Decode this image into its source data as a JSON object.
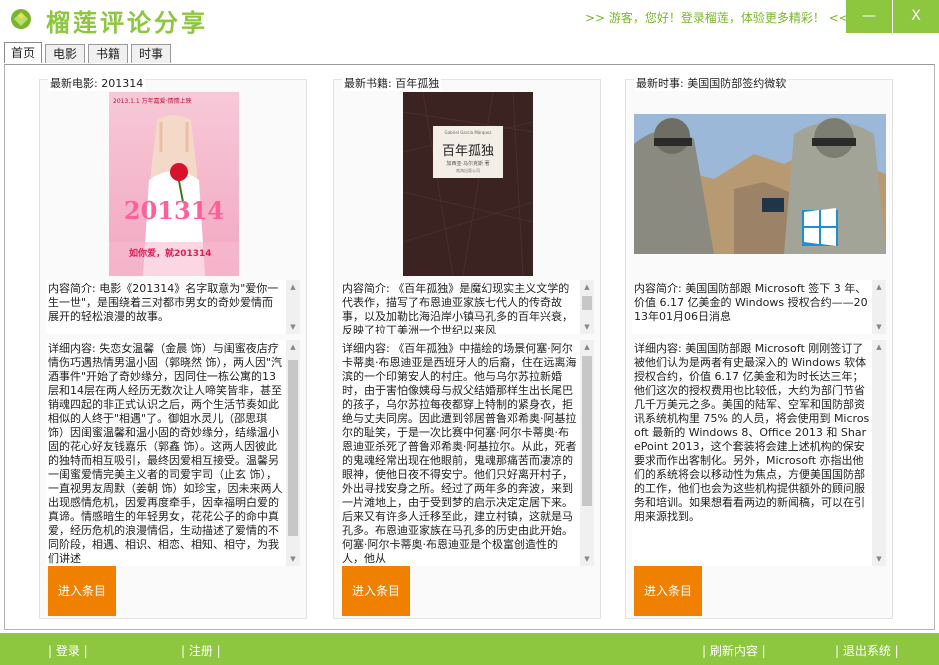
{
  "app": {
    "title": "榴莲评论分享",
    "guest_message": ">> 游客，您好！登录榴莲，体验更多精彩！ <<",
    "minimize_label": "—",
    "close_label": "X"
  },
  "tabs": [
    {
      "label": "首页",
      "active": true
    },
    {
      "label": "电影",
      "active": false
    },
    {
      "label": "书籍",
      "active": false
    },
    {
      "label": "时事",
      "active": false
    }
  ],
  "movie": {
    "heading": "最新电影: 201314",
    "poster_top_text": "2013.1.1 万年嘉爱·情情上映",
    "poster_big_text": "201314",
    "poster_small_text": "Forever Love",
    "poster_bottom_text": "如你爱，就201314",
    "summary": "内容简介: 电影《201314》名字取意为\"爱你一生一世\"，是围绕着三对都市男女的奇妙爱情而展开的轻松浪漫的故事。",
    "detail": "详细内容: 失恋女温馨（金晨 饰）与闺蜜夜店疗情伤巧遇热情男温小固（郭晓然 饰），两人因\"汽酒事件\"开始了奇妙缘分，因同住一栋公寓的13层和14层在两人经历无数次让人啼笑皆非，甚至销魂四起的非正式认识之后，两个生活节奏如此相似的人终于\"相遇\"了。御姐水灵儿（邵思琪 饰）因闺蜜温馨和温小固的奇妙缘分，结缘温小固的花心好友钱嘉乐（郭鑫 饰）。这两人因彼此的独特而相互吸引，最终因爱相互接受。温馨另一闺蜜爱情完美主义者的司爱宇司（止玄 饰），一直视男友周默（姜朝 饰）如珍宝，因未来两人出现感情危机，因爱再度牵手，因幸福明白爱的真谛。情感暗生的年轻男女，花花公子的命中真爱，经历危机的浪漫情侣，生动描述了爱情的不同阶段，相遇、相识、相恋、相知、相守，为我们讲述",
    "enter_label": "进入条目"
  },
  "book": {
    "heading": "最新书籍: 百年孤独",
    "cover_top_text": "Gabriel García Márquez",
    "cover_title": "百年孤独",
    "cover_author": "加西亚·马尔克斯 著",
    "cover_bottom_text": "南海出版公司",
    "summary": "内容简介: 《百年孤独》是魔幻现实主义文学的代表作，描写了布恩迪亚家族七代人的传奇故事，以及加勒比海沿岸小镇马孔多的百年兴衰，反映了拉丁美洲一个世纪以来风",
    "detail": "详细内容: 《百年孤独》中描绘的场景何塞·阿尔卡蒂奥·布恩迪亚是西班牙人的后裔，住在远离海滨的一个印第安人的村庄。他与乌尔苏拉新婚时，由于害怕像姨母与叔父结婚那样生出长尾巴的孩子，乌尔苏拉每夜都穿上特制的紧身衣，拒绝与丈夫同房。因此遭到邻居普鲁邓希奥·阿基拉尔的耻笑，于是一次比赛中何塞·阿尔卡蒂奥·布恩迪亚杀死了普鲁邓希奥·阿基拉尔。从此，死者的鬼魂经常出现在他眼前，鬼魂那痛苦而凄凉的眼神，使他日夜不得安宁。他们只好离开村子，外出寻找安身之所。经过了两年多的奔波，来到一片滩地上，由于受到梦的启示决定定居下来。后来又有许多人迁移至此，建立村镇，这就是马孔多。布恩迪亚家族在马孔多的历史由此开始。 何塞·阿尔卡蒂奥·布恩迪亚是个极富创造性的人，他从",
    "enter_label": "进入条目"
  },
  "news": {
    "heading": "最新时事: 美国国防部签约微软",
    "summary": "内容简介: 美国国防部跟 Microsoft 签下 3 年、价值 6.17 亿美金的 Windows 授权合约——2013年01月06日消息",
    "detail": "详细内容: 美国国防部跟 Microsoft 刚刚签订了被他们认为是两者有史最深入的 Windows 软体授权合约，价值 6.17 亿美金和为时长达三年；他们这次的授权费用也比较低，大约为部门节省几千万美元之多。美国的陆军、空军和国防部资讯系统机构里 75% 的人员，将会使用到 Microsoft 最新的 Windows 8、Office 2013 和 SharePoint 2013，这个套装将会建上述机构的保安要求而作出客制化。另外，Microsoft 亦指出他们的系统将会以移动性为焦点，方便美国国防部的工作，他们也会为这些机构提供额外的顾问服务和培训。如果想看看两边的新闻稿，可以在引用来源找到。",
    "enter_label": "进入条目"
  },
  "footer": {
    "login": "| 登录 |",
    "register": "| 注册 |",
    "refresh": "| 刷新内容 |",
    "exit": "| 退出系统 |"
  },
  "colors": {
    "brand_green": "#8dc63f",
    "button_orange": "#f08000"
  }
}
